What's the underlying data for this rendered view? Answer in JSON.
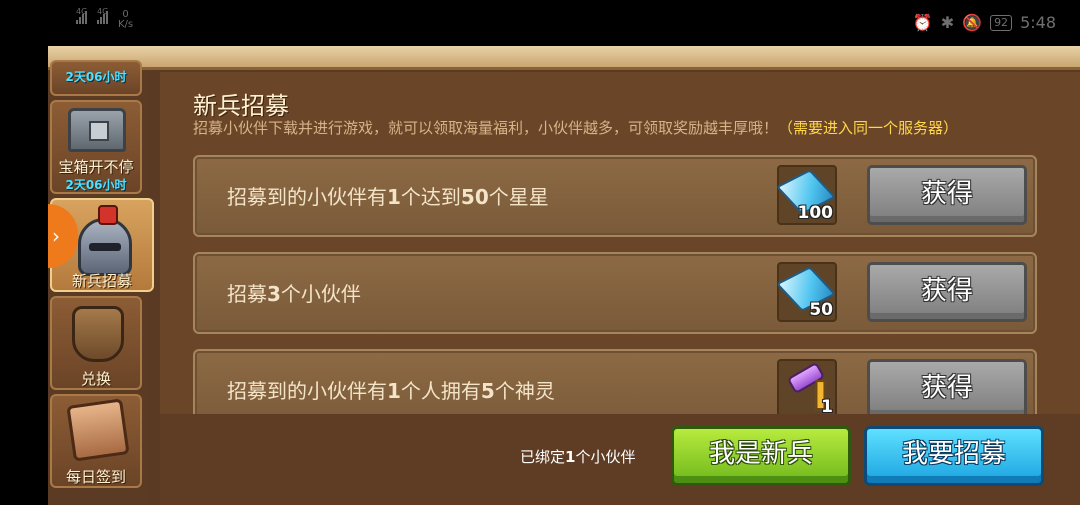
{
  "status_bar": {
    "signal1": "4G",
    "signal2": "4G",
    "net_speed": "0",
    "net_unit": "K/s",
    "battery": "92",
    "time": "5:48"
  },
  "sidebar": {
    "items": [
      {
        "label": "",
        "countdown": "2天06小时"
      },
      {
        "label": "宝箱开不停",
        "countdown": "2天06小时",
        "icon": "chest-icon"
      },
      {
        "label": "新兵招募",
        "icon": "helmet-icon",
        "active": true
      },
      {
        "label": "兑换",
        "icon": "bag-icon"
      },
      {
        "label": "每日签到",
        "icon": "scroll-icon"
      }
    ],
    "arrow": "›"
  },
  "panel": {
    "title": "新兵招募",
    "description": "招募小伙伴下载并进行游戏，就可以领取海量福利，小伙伴越多，可领取奖励越丰厚哦！",
    "note": "（需要进入同一个服务器）"
  },
  "tasks": [
    {
      "pre": "招募到的小伙伴有",
      "n1": "1",
      "mid": "个达到",
      "n2": "50",
      "post": "个星星",
      "reward_icon": "diamond-icon",
      "reward_qty": "100",
      "button": "获得"
    },
    {
      "pre": "招募",
      "n1": "3",
      "mid": "个小伙伴",
      "n2": "",
      "post": "",
      "reward_icon": "diamond-icon",
      "reward_qty": "50",
      "button": "获得"
    },
    {
      "pre": "招募到的小伙伴有",
      "n1": "1",
      "mid": "个人拥有",
      "n2": "5",
      "post": "个神灵",
      "reward_icon": "hammer-icon",
      "reward_qty": "1",
      "button": "获得"
    }
  ],
  "footer": {
    "bound_pre": "已绑定",
    "bound_count": "1",
    "bound_post": "个小伙伴",
    "newbie_button": "我是新兵",
    "recruit_button": "我要招募"
  }
}
